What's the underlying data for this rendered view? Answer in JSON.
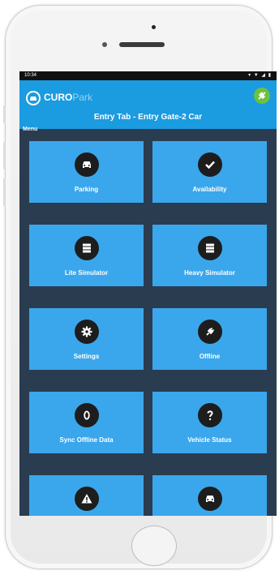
{
  "status_bar": {
    "time": "10:34",
    "icons": "▾ ▼ ◢ ▮"
  },
  "header": {
    "brand": "CURO",
    "brand_suffix": "Park",
    "title": "Entry Tab - Entry Gate-2 Car",
    "menu_label": "Menu"
  },
  "tiles": [
    {
      "label": "Parking",
      "icon": "car-icon"
    },
    {
      "label": "Availability",
      "icon": "check-icon"
    },
    {
      "label": "Lite Simulator",
      "icon": "server-icon"
    },
    {
      "label": "Heavy Simulator",
      "icon": "server-icon"
    },
    {
      "label": "Settings",
      "icon": "gear-icon"
    },
    {
      "label": "Offline",
      "icon": "plug-icon"
    },
    {
      "label": "Sync Offline Data",
      "icon": "zero-icon"
    },
    {
      "label": "Vehicle Status",
      "icon": "question-icon"
    },
    {
      "label": "",
      "icon": "warning-icon"
    },
    {
      "label": "",
      "icon": "car-icon"
    }
  ],
  "colors": {
    "app_bar": "#1b9be0",
    "tile": "#3aa7ec",
    "background": "#2a3c50",
    "connection_status": "#6cc23a"
  }
}
